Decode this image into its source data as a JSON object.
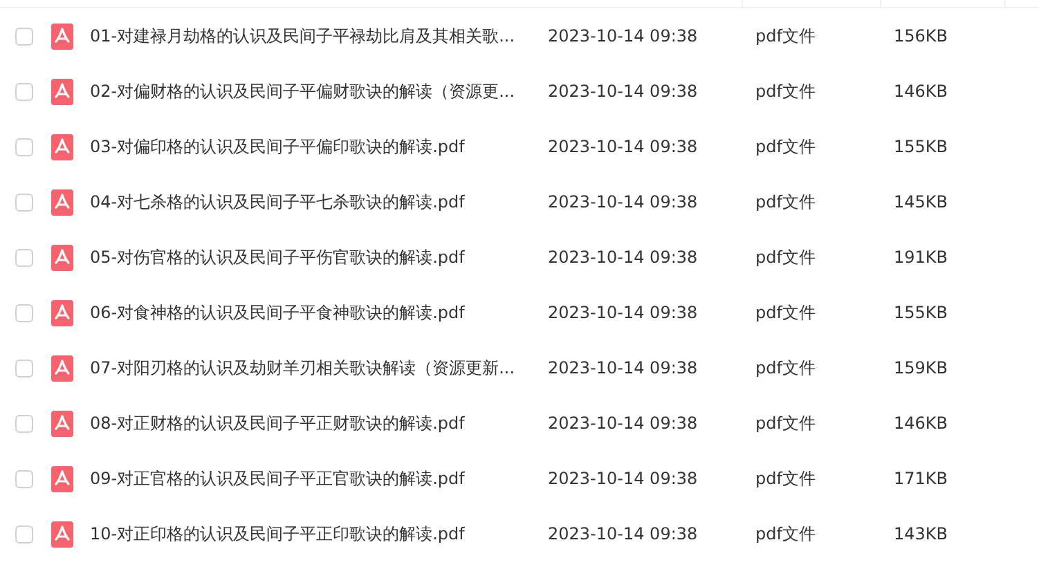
{
  "files": [
    {
      "name": "01-对建禄月劫格的认识及民间子平禄劫比肩及其相关歌...",
      "date": "2023-10-14 09:38",
      "type": "pdf文件",
      "size": "156KB",
      "checked": false
    },
    {
      "name": "02-对偏财格的认识及民间子平偏财歌诀的解读（资源更...",
      "date": "2023-10-14 09:38",
      "type": "pdf文件",
      "size": "146KB",
      "checked": false
    },
    {
      "name": "03-对偏印格的认识及民间子平偏印歌诀的解读.pdf",
      "date": "2023-10-14 09:38",
      "type": "pdf文件",
      "size": "155KB",
      "checked": false
    },
    {
      "name": "04-对七杀格的认识及民间子平七杀歌诀的解读.pdf",
      "date": "2023-10-14 09:38",
      "type": "pdf文件",
      "size": "145KB",
      "checked": false
    },
    {
      "name": "05-对伤官格的认识及民间子平伤官歌诀的解读.pdf",
      "date": "2023-10-14 09:38",
      "type": "pdf文件",
      "size": "191KB",
      "checked": false
    },
    {
      "name": "06-对食神格的认识及民间子平食神歌诀的解读.pdf",
      "date": "2023-10-14 09:38",
      "type": "pdf文件",
      "size": "155KB",
      "checked": false
    },
    {
      "name": "07-对阳刃格的认识及劫财羊刃相关歌诀解读（资源更新...",
      "date": "2023-10-14 09:38",
      "type": "pdf文件",
      "size": "159KB",
      "checked": false
    },
    {
      "name": "08-对正财格的认识及民间子平正财歌诀的解读.pdf",
      "date": "2023-10-14 09:38",
      "type": "pdf文件",
      "size": "146KB",
      "checked": false
    },
    {
      "name": "09-对正官格的认识及民间子平正官歌诀的解读.pdf",
      "date": "2023-10-14 09:38",
      "type": "pdf文件",
      "size": "171KB",
      "checked": false
    },
    {
      "name": "10-对正印格的认识及民间子平正印歌诀的解读.pdf",
      "date": "2023-10-14 09:38",
      "type": "pdf文件",
      "size": "143KB",
      "checked": false
    }
  ]
}
